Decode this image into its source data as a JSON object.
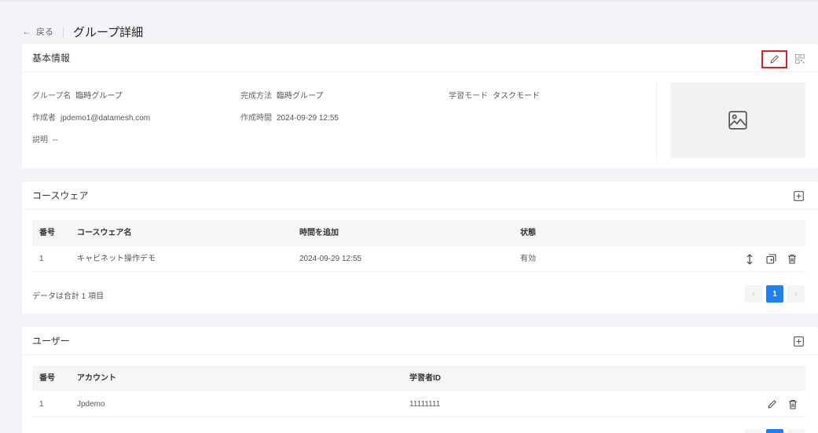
{
  "header": {
    "back_label": "戻る",
    "title": "グループ詳細"
  },
  "basic_info": {
    "title": "基本情報",
    "fields": [
      {
        "label": "グループ名",
        "value": "臨時グループ"
      },
      {
        "label": "完成方法",
        "value": "臨時グループ"
      },
      {
        "label": "学習モード",
        "value": "タスクモード"
      },
      {
        "label": "作成者",
        "value": "jpdemo1@datamesh.com"
      },
      {
        "label": "作成時間",
        "value": "2024-09-29 12:55"
      },
      {
        "label": "説明",
        "value": "--"
      }
    ]
  },
  "courseware": {
    "title": "コースウェア",
    "columns": [
      "番号",
      "コースウェア名",
      "時間を追加",
      "状態"
    ],
    "rows": [
      {
        "no": "1",
        "name": "キャビネット操作デモ",
        "added": "2024-09-29 12:55",
        "status": "有効"
      }
    ],
    "total": "データは合計 1 項目",
    "pagination": {
      "prev": "‹",
      "current": "1",
      "next": "›"
    }
  },
  "users": {
    "title": "ユーザー",
    "columns": [
      "番号",
      "アカウント",
      "学習者ID"
    ],
    "rows": [
      {
        "no": "1",
        "account": "Jpdemo",
        "learner_id": "11111111"
      }
    ]
  },
  "colors": {
    "accent": "#1f7ff0",
    "highlight": "#e02020",
    "background": "#f3f4f7"
  }
}
